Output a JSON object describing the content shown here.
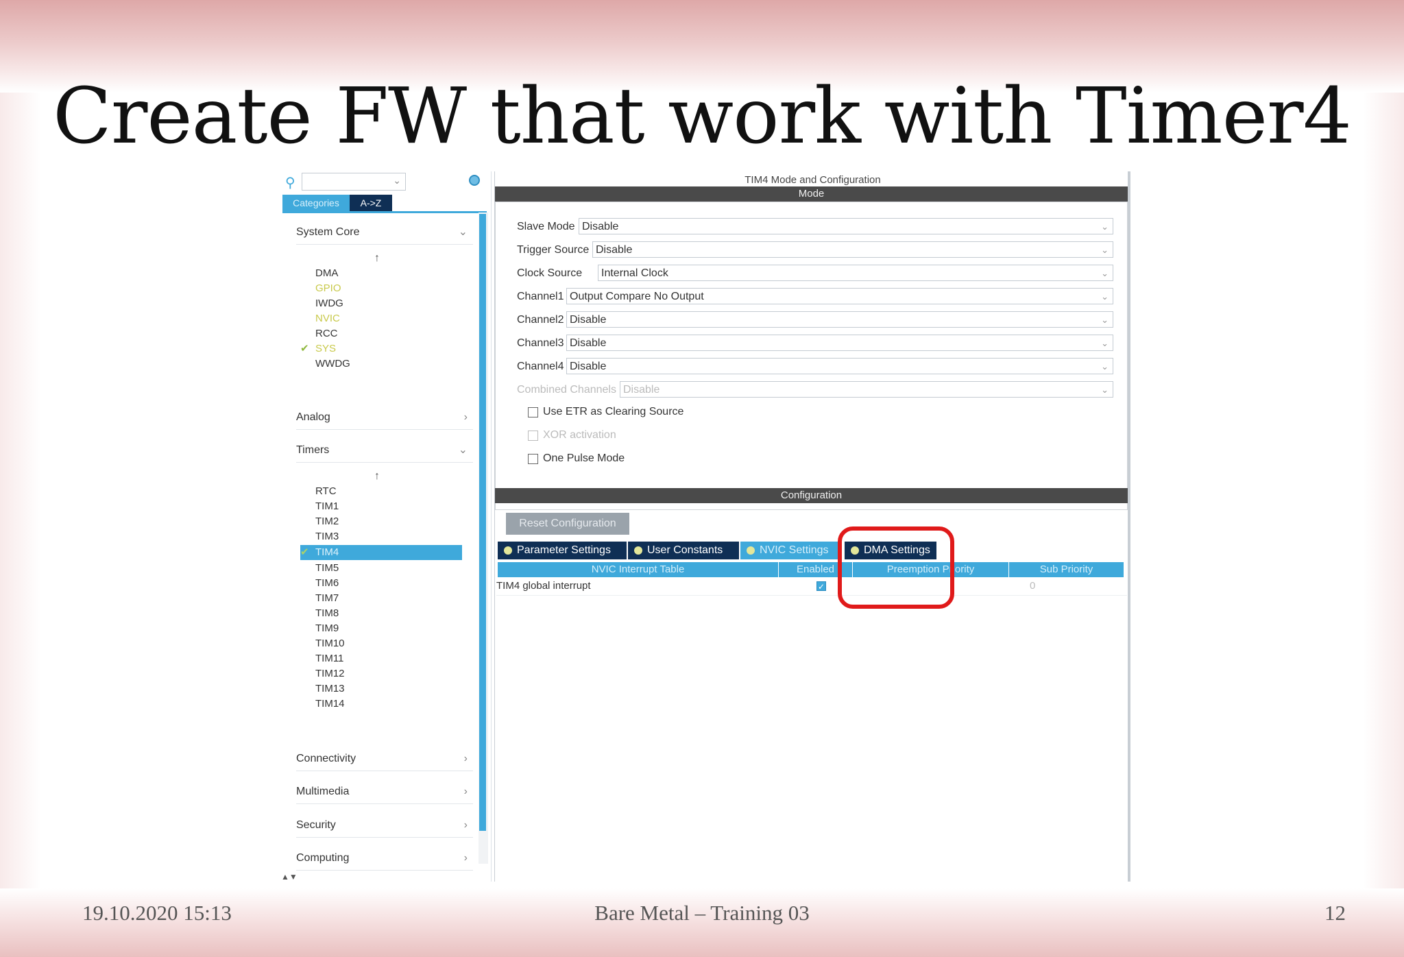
{
  "slide": {
    "title": "Create FW that work with Timer4",
    "footer_date": "19.10.2020 15:13",
    "footer_center": "Bare Metal – Training 03",
    "page_number": "12"
  },
  "left_panel": {
    "search_icon": "search-icon",
    "tabs": {
      "categories": "Categories",
      "az": "A->Z"
    },
    "system_core": {
      "label": "System Core",
      "items": [
        "DMA",
        "GPIO",
        "IWDG",
        "NVIC",
        "RCC",
        "SYS",
        "WWDG"
      ]
    },
    "analog": {
      "label": "Analog"
    },
    "timers": {
      "label": "Timers",
      "items": [
        "RTC",
        "TIM1",
        "TIM2",
        "TIM3",
        "TIM4",
        "TIM5",
        "TIM6",
        "TIM7",
        "TIM8",
        "TIM9",
        "TIM10",
        "TIM11",
        "TIM12",
        "TIM13",
        "TIM14"
      ],
      "selected": "TIM4"
    },
    "connectivity": {
      "label": "Connectivity"
    },
    "multimedia": {
      "label": "Multimedia"
    },
    "security": {
      "label": "Security"
    },
    "computing": {
      "label": "Computing"
    }
  },
  "right_panel": {
    "title": "TIM4 Mode and Configuration",
    "mode_bar": "Mode",
    "mode": {
      "slave_mode": {
        "label": "Slave Mode",
        "value": "Disable"
      },
      "trigger_source": {
        "label": "Trigger Source",
        "value": "Disable"
      },
      "clock_source": {
        "label": "Clock Source",
        "value": "Internal Clock"
      },
      "channel1": {
        "label": "Channel1",
        "value": "Output Compare No Output"
      },
      "channel2": {
        "label": "Channel2",
        "value": "Disable"
      },
      "channel3": {
        "label": "Channel3",
        "value": "Disable"
      },
      "channel4": {
        "label": "Channel4",
        "value": "Disable"
      },
      "combined_channels": {
        "label": "Combined Channels",
        "value": "Disable"
      },
      "use_etr": "Use ETR as Clearing Source",
      "xor_activation": "XOR activation",
      "one_pulse_mode": "One Pulse Mode"
    },
    "config_bar": "Configuration",
    "reset_button": "Reset Configuration",
    "tabs": [
      "Parameter Settings",
      "User Constants",
      "NVIC Settings",
      "DMA Settings"
    ],
    "active_tab": "NVIC Settings",
    "table": {
      "headers": [
        "NVIC Interrupt Table",
        "Enabled",
        "Preemption Priority",
        "Sub Priority"
      ],
      "rows": [
        {
          "name": "TIM4 global interrupt",
          "enabled": true,
          "preemption": "",
          "sub": "0"
        }
      ]
    }
  },
  "colors": {
    "accent_blue": "#3fa9db",
    "navy": "#0f2f55",
    "highlight_red": "#e01a1a"
  }
}
